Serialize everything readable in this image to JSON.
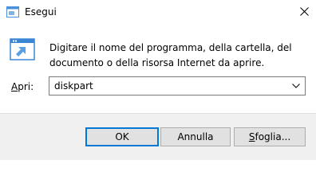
{
  "window": {
    "title": "Esegui"
  },
  "description": {
    "line1": "Digitare il nome del programma, della cartella, del",
    "line2": "documento o della risorsa Internet da aprire."
  },
  "open_field": {
    "label_accel": "A",
    "label_rest": "pri:",
    "value": "diskpart"
  },
  "buttons": {
    "ok": "OK",
    "cancel": "Annulla",
    "browse_accel": "S",
    "browse_rest": "foglia..."
  },
  "icons": {
    "app": "run-dialog-icon",
    "close": "close-icon",
    "dropdown": "chevron-down-icon"
  },
  "colors": {
    "default_button_border": "#0078d7",
    "footer_background": "#f0f0f0"
  }
}
